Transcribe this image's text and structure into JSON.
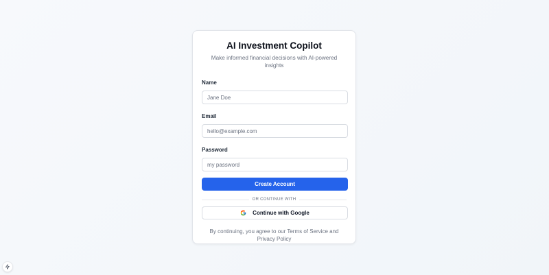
{
  "card": {
    "title": "AI Investment Copilot",
    "subtitle": "Make informed financial decisions with AI-powered insights"
  },
  "form": {
    "name_label": "Name",
    "name_placeholder": "Jane Doe",
    "name_value": "",
    "email_label": "Email",
    "email_placeholder": "hello@example.com",
    "email_value": "",
    "password_label": "Password",
    "password_placeholder": "my password",
    "password_value": "",
    "submit_label": "Create Account"
  },
  "divider": {
    "text": "OR CONTINUE WITH"
  },
  "google": {
    "label": "Continue with Google",
    "icon": "google-icon"
  },
  "terms": {
    "text": "By continuing, you agree to our Terms of Service and Privacy Policy"
  },
  "badge": {
    "icon": "lightning-icon"
  },
  "colors": {
    "primary": "#2563eb",
    "background": "#f5f7fa",
    "card": "#ffffff",
    "muted_text": "#6b7280",
    "border": "#d8dce2"
  }
}
